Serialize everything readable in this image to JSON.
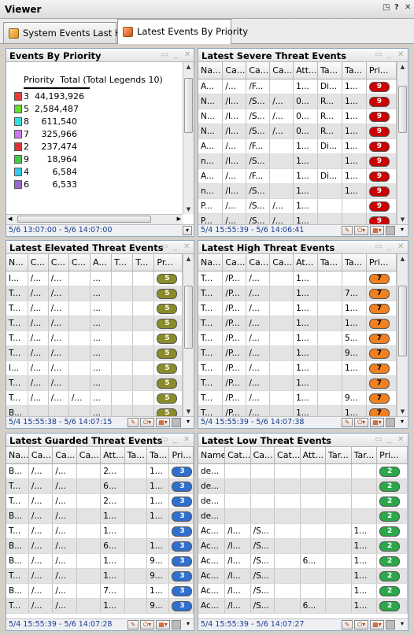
{
  "window": {
    "title": "Viewer",
    "controls": [
      "◳",
      "?",
      "✕"
    ]
  },
  "tabs": [
    {
      "label": "System Events Last Hour"
    },
    {
      "label": "Latest Events By Priority"
    }
  ],
  "colors": {
    "p9": "#cc0000",
    "p7": "#f08020",
    "p5": "#8b8b2a",
    "p3": "#2f6fd0",
    "p2": "#2aa84a"
  },
  "legend_panel": {
    "title": "Events By Priority",
    "header": "Priority  Total (Total Legends 10)",
    "time_range": "5/6 13:07:00 - 5/6 14:07:00",
    "items": [
      {
        "priority": "3",
        "total": "44,193,926",
        "color": "#e63b3b"
      },
      {
        "priority": "5",
        "total": "2,584,487",
        "color": "#66dd33"
      },
      {
        "priority": "8",
        "total": "611,540",
        "color": "#33dddd"
      },
      {
        "priority": "7",
        "total": "325,966",
        "color": "#cc77ee"
      },
      {
        "priority": "2",
        "total": "237,474",
        "color": "#dd3333"
      },
      {
        "priority": "9",
        "total": "18,964",
        "color": "#44cc44"
      },
      {
        "priority": "4",
        "total": "6,584",
        "color": "#33ccee"
      },
      {
        "priority": "6",
        "total": "6,533",
        "color": "#9966cc"
      }
    ]
  },
  "severe": {
    "title": "Latest Severe Threat Events",
    "time_range": "5/4 15:55:39 - 5/6 14:06:41",
    "columns": [
      "Na...",
      "Ca...",
      "Ca...",
      "Ca...",
      "Att...",
      "Ta...",
      "Ta...",
      "Pri..."
    ],
    "rows": [
      [
        "A...",
        "/...",
        "/F...",
        "",
        "1...",
        "Di...",
        "1...",
        "9"
      ],
      [
        "N...",
        "/I...",
        "/S...",
        "/...",
        "0...",
        "R...",
        "1...",
        "9"
      ],
      [
        "N...",
        "/I...",
        "/S...",
        "/...",
        "0...",
        "R...",
        "1...",
        "9"
      ],
      [
        "N...",
        "/I...",
        "/S...",
        "/...",
        "0...",
        "R...",
        "1...",
        "9"
      ],
      [
        "A...",
        "/...",
        "/F...",
        "",
        "1...",
        "Di...",
        "1...",
        "9"
      ],
      [
        "n...",
        "/I...",
        "/S...",
        "",
        "1...",
        "",
        "1...",
        "9"
      ],
      [
        "A...",
        "/...",
        "/F...",
        "",
        "1...",
        "Di...",
        "1...",
        "9"
      ],
      [
        "n...",
        "/I...",
        "/S...",
        "",
        "1...",
        "",
        "1...",
        "9"
      ],
      [
        "P...",
        "/...",
        "/S...",
        "/...",
        "1...",
        "",
        "",
        "9"
      ],
      [
        "P...",
        "/...",
        "/S...",
        "/...",
        "1...",
        "",
        "",
        "9"
      ]
    ]
  },
  "elevated": {
    "title": "Latest Elevated Threat Events",
    "time_range": "5/4 15:55:38 - 5/6 14:07:15",
    "columns": [
      "N...",
      "C...",
      "C...",
      "C...",
      "A...",
      "T...",
      "T...",
      "Pr..."
    ],
    "rows": [
      [
        "I...",
        "/...",
        "/...",
        "",
        "...",
        "",
        "",
        "5"
      ],
      [
        "T...",
        "/...",
        "/...",
        "",
        "...",
        "",
        "",
        "5"
      ],
      [
        "T...",
        "/...",
        "/...",
        "",
        "...",
        "",
        "",
        "5"
      ],
      [
        "T...",
        "/...",
        "/...",
        "",
        "...",
        "",
        "",
        "5"
      ],
      [
        "T...",
        "/...",
        "/...",
        "",
        "...",
        "",
        "",
        "5"
      ],
      [
        "T...",
        "/...",
        "/...",
        "",
        "...",
        "",
        "",
        "5"
      ],
      [
        "I...",
        "/...",
        "/...",
        "",
        "...",
        "",
        "",
        "5"
      ],
      [
        "T...",
        "/...",
        "/...",
        "",
        "...",
        "",
        "",
        "5"
      ],
      [
        "T...",
        "/...",
        "/...",
        "/...",
        "...",
        "",
        "",
        "5"
      ],
      [
        "B...",
        "",
        "",
        "",
        "...",
        "",
        "",
        "5"
      ],
      [
        "B...",
        "",
        "",
        "",
        "...",
        "",
        "",
        "5"
      ]
    ]
  },
  "high": {
    "title": "Latest High Threat Events",
    "time_range": "5/4 15:55:39 - 5/6 14:07:38",
    "columns": [
      "Na...",
      "Ca...",
      "Ca...",
      "Ca...",
      "At...",
      "Ta...",
      "Ta...",
      "Pri..."
    ],
    "rows": [
      [
        "T...",
        "/P...",
        "/...",
        "",
        "1...",
        "",
        "",
        "7"
      ],
      [
        "T...",
        "/P...",
        "/...",
        "",
        "1...",
        "",
        "7...",
        "7"
      ],
      [
        "T...",
        "/P...",
        "/...",
        "",
        "1...",
        "",
        "1...",
        "7"
      ],
      [
        "T...",
        "/P...",
        "/...",
        "",
        "1...",
        "",
        "1...",
        "7"
      ],
      [
        "T...",
        "/P...",
        "/...",
        "",
        "1...",
        "",
        "5...",
        "7"
      ],
      [
        "T...",
        "/P...",
        "/...",
        "",
        "1...",
        "",
        "9...",
        "7"
      ],
      [
        "T...",
        "/P...",
        "/...",
        "",
        "1...",
        "",
        "1...",
        "7"
      ],
      [
        "T...",
        "/P...",
        "/...",
        "",
        "1...",
        "",
        "",
        "7"
      ],
      [
        "T...",
        "/P...",
        "/...",
        "",
        "1...",
        "",
        "9...",
        "7"
      ],
      [
        "T...",
        "/P...",
        "/...",
        "",
        "1...",
        "",
        "1...",
        "7"
      ]
    ]
  },
  "guarded": {
    "title": "Latest Guarded Threat Events",
    "time_range": "5/4 15:55:39 - 5/6 14:07:28",
    "columns": [
      "Na...",
      "Ca...",
      "Ca...",
      "Ca...",
      "Att...",
      "Ta...",
      "Ta...",
      "Pri..."
    ],
    "rows": [
      [
        "B...",
        "/...",
        "/...",
        "",
        "2...",
        "",
        "1...",
        "3"
      ],
      [
        "T...",
        "/...",
        "/...",
        "",
        "6...",
        "",
        "1...",
        "3"
      ],
      [
        "T...",
        "/...",
        "/...",
        "",
        "2...",
        "",
        "1...",
        "3"
      ],
      [
        "B...",
        "/...",
        "/...",
        "",
        "1...",
        "",
        "1...",
        "3"
      ],
      [
        "T...",
        "/...",
        "/...",
        "",
        "1...",
        "",
        "",
        "3"
      ],
      [
        "B...",
        "/...",
        "/...",
        "",
        "6...",
        "",
        "1...",
        "3"
      ],
      [
        "B...",
        "/...",
        "/...",
        "",
        "1...",
        "",
        "9...",
        "3"
      ],
      [
        "T...",
        "/...",
        "/...",
        "",
        "1...",
        "",
        "9...",
        "3"
      ],
      [
        "B...",
        "/...",
        "/...",
        "",
        "7...",
        "",
        "1...",
        "3"
      ],
      [
        "T...",
        "/...",
        "/...",
        "",
        "1...",
        "",
        "9...",
        "3"
      ]
    ]
  },
  "low": {
    "title": "Latest Low Threat Events",
    "time_range": "5/4 15:55:39 - 5/6 14:07:27",
    "columns": [
      "Name",
      "Cat...",
      "Ca...",
      "Cat...",
      "Att...",
      "Tar...",
      "Tar...",
      "Pri..."
    ],
    "rows": [
      [
        "de...",
        "",
        "",
        "",
        "",
        "",
        "",
        "2"
      ],
      [
        "de...",
        "",
        "",
        "",
        "",
        "",
        "",
        "2"
      ],
      [
        "de...",
        "",
        "",
        "",
        "",
        "",
        "",
        "2"
      ],
      [
        "de...",
        "",
        "",
        "",
        "",
        "",
        "",
        "2"
      ],
      [
        "Ac...",
        "/I...",
        "/S...",
        "",
        "",
        "",
        "1...",
        "2"
      ],
      [
        "Ac...",
        "/I...",
        "/S...",
        "",
        "",
        "",
        "1...",
        "2"
      ],
      [
        "Ac...",
        "/I...",
        "/S...",
        "",
        "6...",
        "",
        "1...",
        "2"
      ],
      [
        "Ac...",
        "/I...",
        "/S...",
        "",
        "",
        "",
        "1...",
        "2"
      ],
      [
        "Ac...",
        "/I...",
        "/S...",
        "",
        "",
        "",
        "1...",
        "2"
      ],
      [
        "Ac...",
        "/I...",
        "/S...",
        "",
        "6...",
        "",
        "1...",
        "2"
      ]
    ]
  }
}
